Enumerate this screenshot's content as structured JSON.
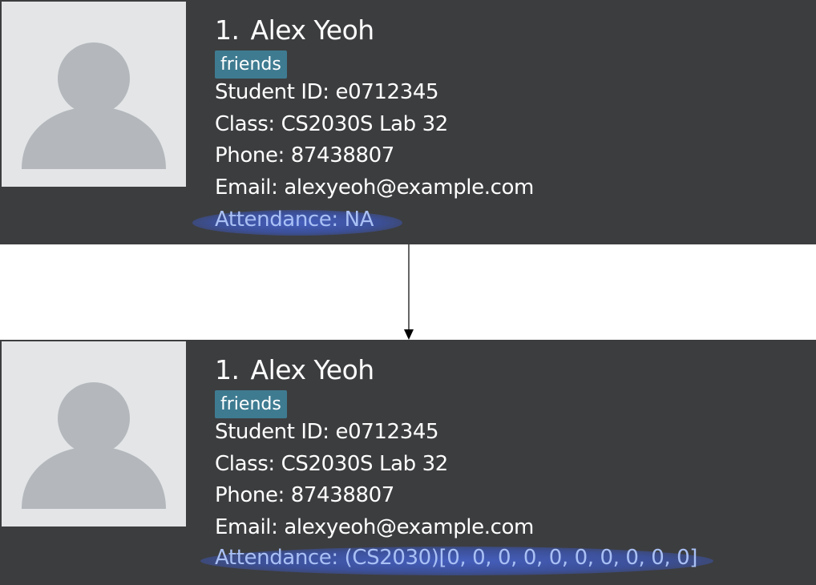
{
  "before": {
    "index": "1.",
    "name": "Alex Yeoh",
    "tag": "friends",
    "student_id": "Student ID: e0712345",
    "class": "Class: CS2030S Lab 32",
    "phone": "Phone: 87438807",
    "email": "Email: alexyeoh@example.com",
    "attendance": "Attendance: NA"
  },
  "after": {
    "index": "1.",
    "name": "Alex Yeoh",
    "tag": "friends",
    "student_id": "Student ID: e0712345",
    "class": "Class: CS2030S Lab 32",
    "phone": "Phone: 87438807",
    "email": "Email: alexyeoh@example.com",
    "attendance": "Attendance: (CS2030)[0, 0, 0, 0, 0, 0, 0, 0, 0, 0]"
  },
  "colors": {
    "card_background": "#3c3d3f",
    "tag_background": "#3e7b91",
    "attendance_text": "#a9c0f5",
    "highlight": "#4a68d0",
    "avatar_background": "#e3e5e7",
    "avatar_silhouette": "#b4b8bc"
  },
  "icons": {
    "avatar": "person-silhouette-icon",
    "connector": "arrow-down-icon"
  }
}
